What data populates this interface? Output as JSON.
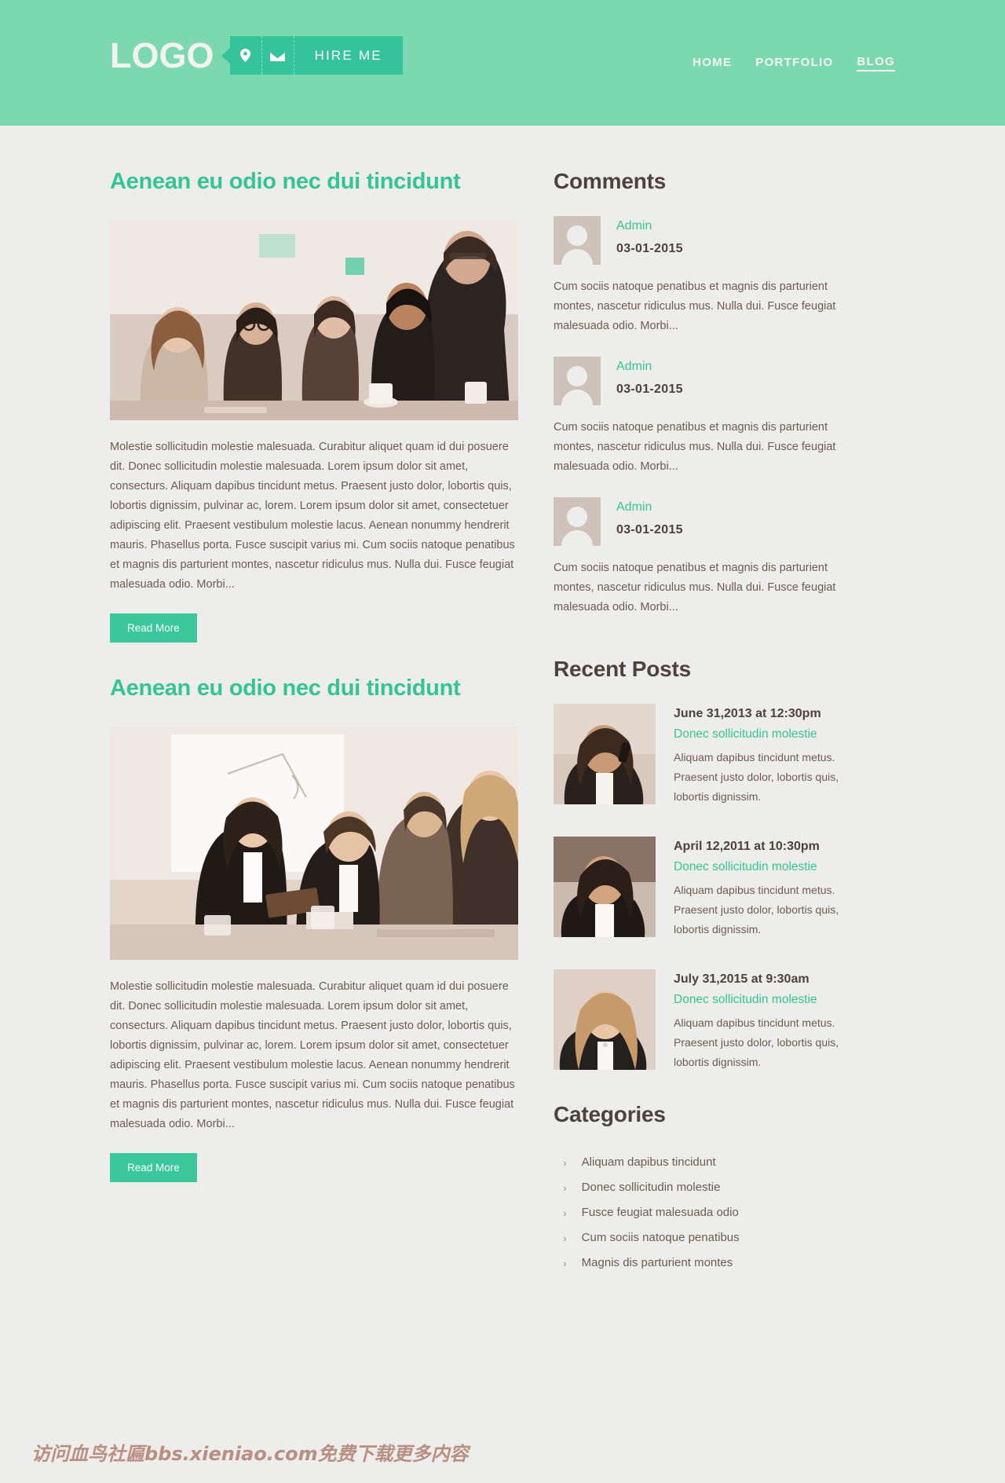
{
  "header": {
    "logo": "LOGO",
    "hire_label": "HIRE ME",
    "pin_icon": "location-pin-icon",
    "mail_icon": "envelope-icon",
    "nav": [
      {
        "label": "HOME",
        "active": false
      },
      {
        "label": "PORTFOLIO",
        "active": false
      },
      {
        "label": "BLOG",
        "active": true
      }
    ],
    "brand_color": "#7cd9af",
    "accent_color": "#34c39a"
  },
  "posts": [
    {
      "title": "Aenean eu odio nec dui tincidunt",
      "image_alt": "group-of-people-in-meeting",
      "body": "Molestie sollicitudin molestie malesuada. Curabitur aliquet quam id dui posuere dit. Donec sollicitudin molestie malesuada. Lorem ipsum dolor sit amet, consecturs. Aliquam dapibus tincidunt metus. Praesent justo dolor, lobortis quis, lobortis dignissim, pulvinar ac, lorem. Lorem ipsum dolor sit amet, consectetuer adipiscing elit. Praesent vestibulum molestie lacus. Aenean nonummy hendrerit mauris. Phasellus porta. Fusce suscipit varius mi. Cum sociis natoque penatibus et magnis dis parturient montes, nascetur ridiculus mus. Nulla dui. Fusce feugiat malesuada odio. Morbi...",
      "read_more": "Read More"
    },
    {
      "title": "Aenean eu odio nec dui tincidunt",
      "image_alt": "business-team-presentation",
      "body": "Molestie sollicitudin molestie malesuada. Curabitur aliquet quam id dui posuere dit. Donec sollicitudin molestie malesuada. Lorem ipsum dolor sit amet, consecturs. Aliquam dapibus tincidunt metus. Praesent justo dolor, lobortis quis, lobortis dignissim, pulvinar ac, lorem. Lorem ipsum dolor sit amet, consectetuer adipiscing elit. Praesent vestibulum molestie lacus. Aenean nonummy hendrerit mauris. Phasellus porta. Fusce suscipit varius mi. Cum sociis natoque penatibus et magnis dis parturient montes, nascetur ridiculus mus. Nulla dui. Fusce feugiat malesuada odio. Morbi...",
      "read_more": "Read More"
    }
  ],
  "sidebar": {
    "comments_title": "Comments",
    "comments": [
      {
        "author": "Admin",
        "date": "03-01-2015",
        "text": "Cum sociis natoque penatibus et magnis dis parturient montes, nascetur ridiculus mus. Nulla dui. Fusce feugiat malesuada odio. Morbi..."
      },
      {
        "author": "Admin",
        "date": "03-01-2015",
        "text": "Cum sociis natoque penatibus et magnis dis parturient montes, nascetur ridiculus mus. Nulla dui. Fusce feugiat malesuada odio. Morbi..."
      },
      {
        "author": "Admin",
        "date": "03-01-2015",
        "text": "Cum sociis natoque penatibus et magnis dis parturient montes, nascetur ridiculus mus. Nulla dui. Fusce feugiat malesuada odio. Morbi..."
      }
    ],
    "recent_title": "Recent Posts",
    "recent_posts": [
      {
        "date": "June 31,2013 at 12:30pm",
        "link": "Donec sollicitudin molestie",
        "desc": "Aliquam dapibus tincidunt metus. Praesent justo dolor, lobortis quis, lobortis dignissim.",
        "image_alt": "woman-on-phone-smiling"
      },
      {
        "date": "April 12,2011 at 10:30pm",
        "link": "Donec sollicitudin molestie",
        "desc": "Aliquam dapibus tincidunt metus. Praesent justo dolor, lobortis quis, lobortis dignissim.",
        "image_alt": "businesswoman-portrait"
      },
      {
        "date": "July 31,2015 at 9:30am",
        "link": "Donec sollicitudin molestie",
        "desc": "Aliquam dapibus tincidunt metus. Praesent justo dolor, lobortis quis, lobortis dignissim.",
        "image_alt": "blonde-woman-portrait"
      }
    ],
    "categories_title": "Categories",
    "categories": [
      "Aliquam dapibus tincidunt",
      "Donec sollicitudin molestie",
      "Fusce feugiat malesuada odio",
      "Cum sociis natoque penatibus",
      "Magnis dis parturient montes"
    ],
    "chevron": "›"
  },
  "watermark": "访问血鸟社匾bbs.xieniao.com免费下载更多内容"
}
